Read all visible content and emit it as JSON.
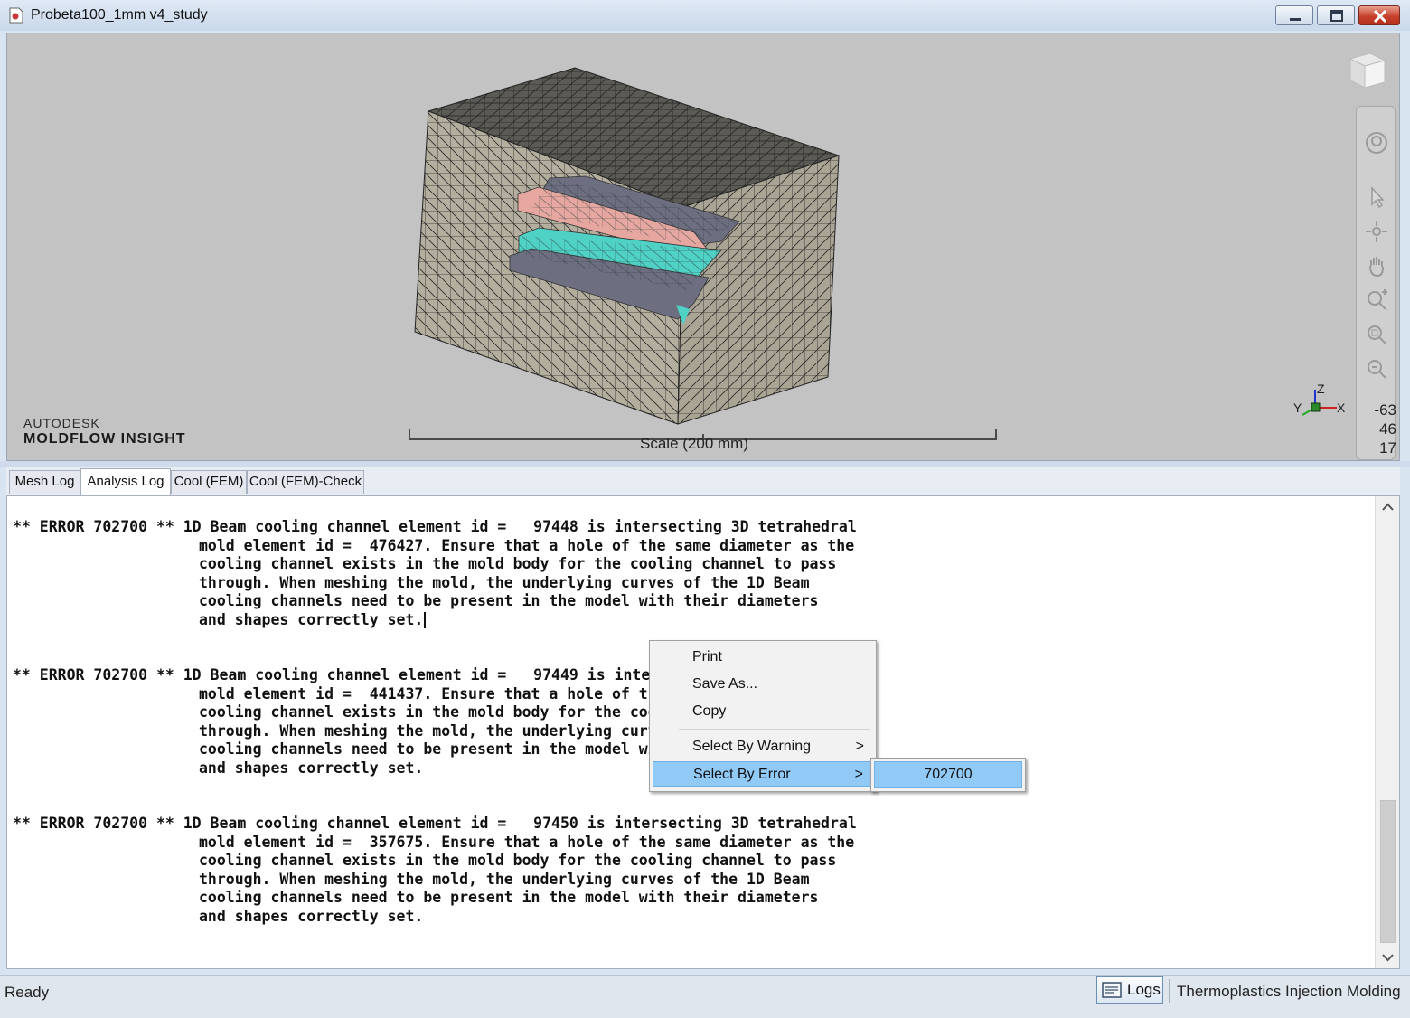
{
  "window": {
    "title": "Probeta100_1mm v4_study",
    "icon": "document-icon",
    "controls": [
      "minimize-icon",
      "maximize-icon",
      "close-icon"
    ]
  },
  "viewport": {
    "brand_top": "AUTODESK",
    "brand_bottom": "MOLDFLOW INSIGHT",
    "scale_label": "Scale (200 mm)",
    "coords": [
      "-63",
      "46",
      "17"
    ],
    "axis_labels": {
      "z": "Z",
      "y": "Y",
      "x": "X"
    },
    "nav_icons": [
      "steering-wheel-icon",
      "select-arrow-icon",
      "pan-orbit-icon",
      "hand-pan-icon",
      "zoom-icon",
      "zoom-window-icon",
      "zoom-fit-icon"
    ]
  },
  "tabs": [
    {
      "label": "Mesh Log",
      "active": false
    },
    {
      "label": "Analysis Log",
      "active": true
    },
    {
      "label": "Cool (FEM)",
      "active": false
    },
    {
      "label": "Cool (FEM)-Check",
      "active": false
    }
  ],
  "log": {
    "entries": [
      {
        "first": "** ERROR 702700 ** 1D Beam cooling channel element id =   97448 is intersecting 3D tetrahedral",
        "rest": [
          "mold element id =  476427. Ensure that a hole of the same diameter as the",
          "cooling channel exists in the mold body for the cooling channel to pass",
          "through. When meshing the mold, the underlying curves of the 1D Beam",
          "cooling channels need to be present in the model with their diameters",
          "and shapes correctly set."
        ]
      },
      {
        "first": "** ERROR 702700 ** 1D Beam cooling channel element id =   97449 is intersecting 3D tetrahedral",
        "rest": [
          "mold element id =  441437. Ensure that a hole of the same diameter as the",
          "cooling channel exists in the mold body for the cooling channel to pass",
          "through. When meshing the mold, the underlying curves of the 1D Beam",
          "cooling channels need to be present in the model with their diameters",
          "and shapes correctly set."
        ]
      },
      {
        "first": "** ERROR 702700 ** 1D Beam cooling channel element id =   97450 is intersecting 3D tetrahedral",
        "rest": [
          "mold element id =  357675. Ensure that a hole of the same diameter as the",
          "cooling channel exists in the mold body for the cooling channel to pass",
          "through. When meshing the mold, the underlying curves of the 1D Beam",
          "cooling channels need to be present in the model with their diameters",
          "and shapes correctly set."
        ]
      }
    ]
  },
  "context_menu": {
    "print": "Print",
    "save_as": "Save As...",
    "copy": "Copy",
    "select_by_warning": "Select By Warning",
    "select_by_error": "Select By Error",
    "submenu_arrow": ">",
    "submenu_item": "702700"
  },
  "status": {
    "text": "Ready",
    "logs_label": "Logs",
    "mode": "Thermoplastics Injection Molding"
  },
  "colors": {
    "mesh_fill": "#b3ae9d",
    "mesh_line": "#2a2a2a",
    "part_cyan": "#4fd1c5",
    "part_pink": "#e7a7a1",
    "part_slate": "#6d6e80",
    "menu_highlight": "#91c9f7"
  }
}
